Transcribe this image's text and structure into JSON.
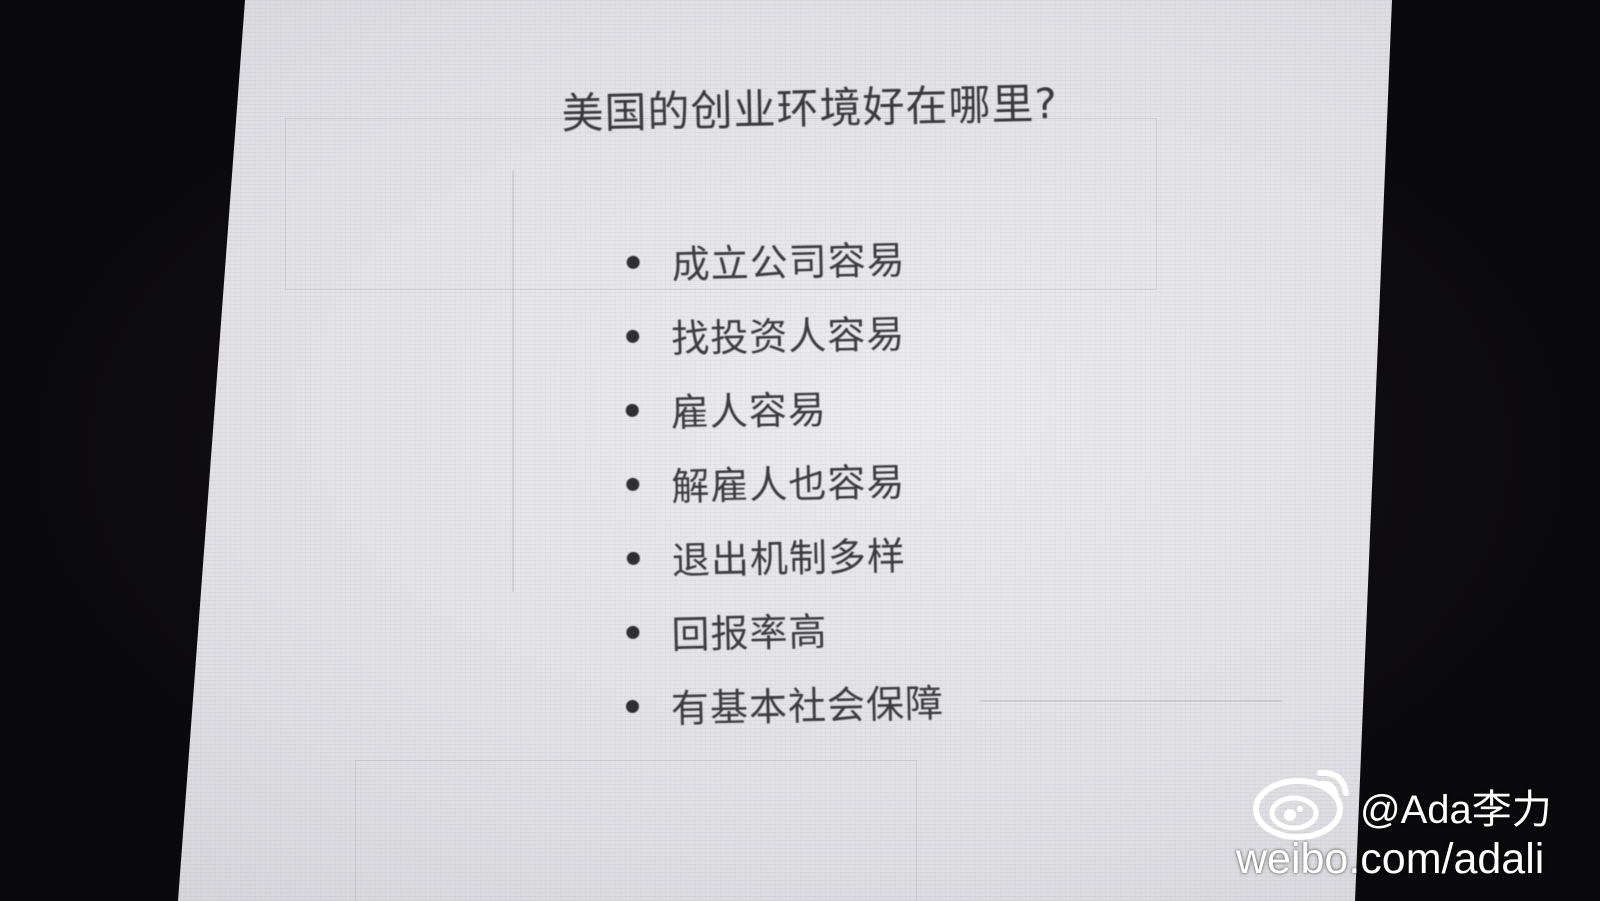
{
  "slide": {
    "title": "美国的创业环境好在哪里?",
    "bullets": [
      "成立公司容易",
      "找投资人容易",
      "雇人容易",
      "解雇人也容易",
      "退出机制多样",
      "回报率高",
      "有基本社会保障"
    ]
  },
  "watermark": {
    "icon": "weibo-logo",
    "handle": "@Ada李力",
    "url": "weibo.com/adali"
  },
  "colors": {
    "background": "#0b0a0c",
    "slide": "#e4e4e9",
    "text": "#3b3b40",
    "watermark_text": "#ffffff"
  }
}
